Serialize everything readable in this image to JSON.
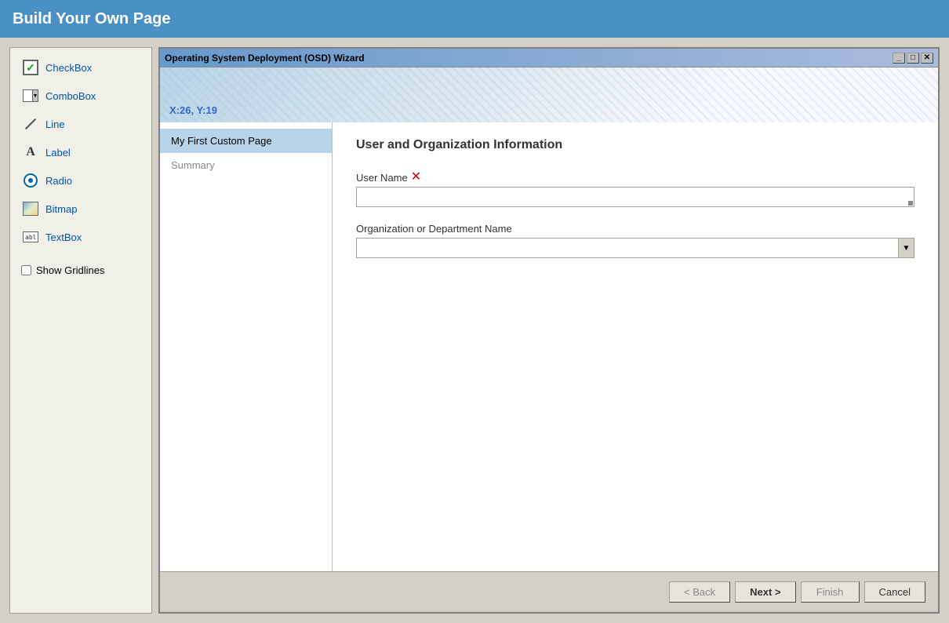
{
  "app": {
    "title": "Build Your Own Page"
  },
  "toolbox": {
    "items": [
      {
        "id": "checkbox",
        "label": "CheckBox",
        "icon": "checkbox-icon"
      },
      {
        "id": "combobox",
        "label": "ComboBox",
        "icon": "combobox-icon"
      },
      {
        "id": "line",
        "label": "Line",
        "icon": "line-icon"
      },
      {
        "id": "label",
        "label": "Label",
        "icon": "label-icon"
      },
      {
        "id": "radio",
        "label": "Radio",
        "icon": "radio-icon"
      },
      {
        "id": "bitmap",
        "label": "Bitmap",
        "icon": "bitmap-icon"
      },
      {
        "id": "textbox",
        "label": "TextBox",
        "icon": "textbox-icon"
      }
    ],
    "show_gridlines_label": "Show Gridlines"
  },
  "wizard": {
    "title": "Operating System Deployment (OSD) Wizard",
    "coords": "X:26, Y:19",
    "nav_items": [
      {
        "id": "custom-page",
        "label": "My First Custom Page",
        "active": true
      },
      {
        "id": "summary",
        "label": "Summary",
        "active": false
      }
    ],
    "content": {
      "section_title": "User and Organization Information",
      "fields": [
        {
          "id": "username",
          "label": "User Name",
          "required": true,
          "type": "text",
          "value": ""
        },
        {
          "id": "orgname",
          "label": "Organization or Department Name",
          "required": false,
          "type": "combo",
          "value": ""
        }
      ]
    },
    "footer": {
      "back_label": "< Back",
      "next_label": "Next >",
      "finish_label": "Finish",
      "cancel_label": "Cancel"
    }
  }
}
